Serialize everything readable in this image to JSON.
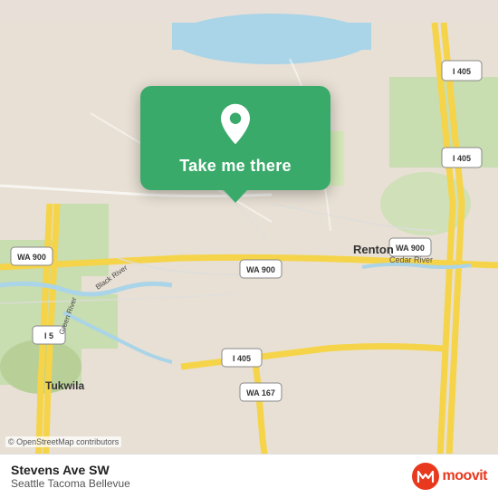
{
  "map": {
    "attribution": "© OpenStreetMap contributors",
    "center_label": "Renton",
    "river_label1": "Black River",
    "river_label2": "Green River",
    "river_label3": "Cedar River",
    "city_label": "Tukwila",
    "highway_labels": [
      "I 405",
      "WA 900",
      "WA 900",
      "I 5",
      "I 405",
      "WA 167",
      "WA 900"
    ],
    "bg_color": "#ede8df"
  },
  "popup": {
    "button_label": "Take me there",
    "pin_color": "white"
  },
  "bottom_bar": {
    "location_name": "Stevens Ave SW",
    "location_region": "Seattle Tacoma Bellevue",
    "moovit_text": "moovit"
  }
}
